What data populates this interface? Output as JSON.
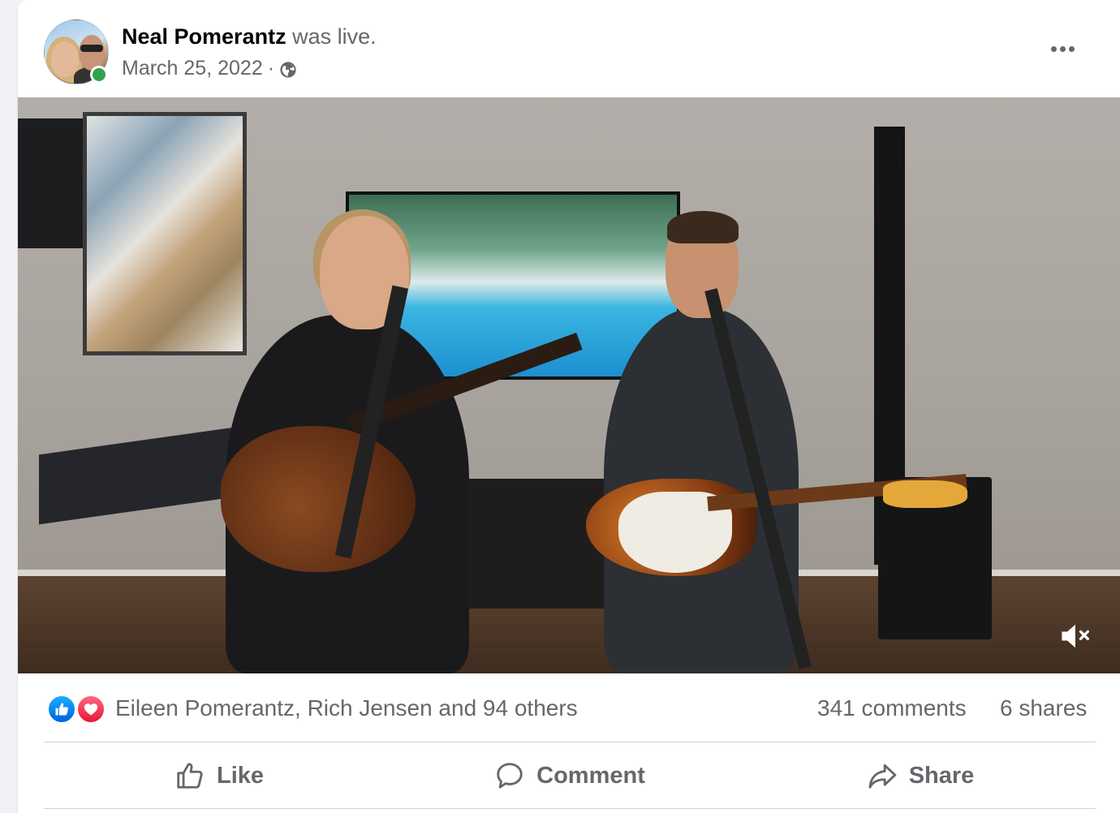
{
  "post": {
    "author_name": "Neal Pomerantz",
    "action_text": "was live.",
    "date": "March 25, 2022",
    "separator": "·",
    "privacy_icon": "globe-icon",
    "more_icon": "more-horizontal-icon"
  },
  "video": {
    "mute_icon": "volume-muted-icon"
  },
  "reactions": {
    "types": [
      "like",
      "love"
    ],
    "reactors_text": "Eileen Pomerantz, Rich Jensen and 94 others",
    "comments_text": "341 comments",
    "shares_text": "6 shares"
  },
  "actions": {
    "like_label": "Like",
    "comment_label": "Comment",
    "share_label": "Share"
  },
  "colors": {
    "secondary_text": "#65676b",
    "online": "#31a24c",
    "like_blue": "#0062df",
    "love_red": "#e61739"
  }
}
